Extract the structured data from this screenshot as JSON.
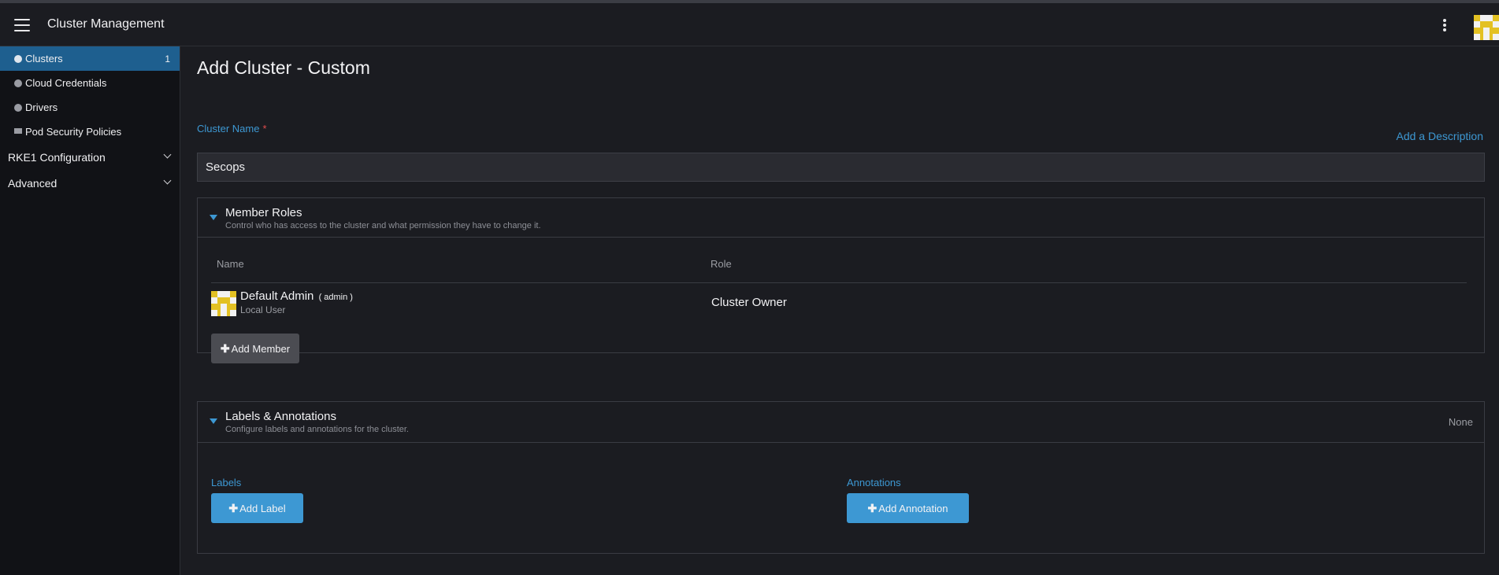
{
  "header": {
    "title": "Cluster Management",
    "menu_icon": "hamburger-icon",
    "more_icon": "kebab-icon"
  },
  "sidebar": {
    "items": [
      {
        "label": "Clusters",
        "count": "1",
        "icon": "cluster-icon",
        "active": true
      },
      {
        "label": "Cloud Credentials",
        "icon": "dot-icon"
      },
      {
        "label": "Drivers",
        "icon": "dot-icon"
      },
      {
        "label": "Pod Security Policies",
        "icon": "folder-icon"
      }
    ],
    "groups": [
      {
        "label": "RKE1 Configuration"
      },
      {
        "label": "Advanced"
      }
    ]
  },
  "main": {
    "title": "Add Cluster - Custom",
    "cluster_name_label": "Cluster Name",
    "required_mark": "*",
    "add_description_link": "Add a Description",
    "cluster_name_value": "Secops",
    "member_roles": {
      "title": "Member Roles",
      "subtitle": "Control who has access to the cluster and what permission they have to change it.",
      "columns": [
        "Name",
        "Role"
      ],
      "members": [
        {
          "name": "Default Admin",
          "username": "( admin )",
          "type": "Local User",
          "role": "Cluster Owner"
        }
      ],
      "add_member_label": "Add Member"
    },
    "labels_annotations": {
      "title": "Labels & Annotations",
      "subtitle": "Configure labels and annotations for the cluster.",
      "status": "None",
      "labels_heading": "Labels",
      "add_label_button": "Add Label",
      "annotations_heading": "Annotations",
      "add_annotation_button": "Add Annotation"
    }
  },
  "colors": {
    "accent": "#3d98d3",
    "active_sidebar": "#1e5f8f",
    "background": "#1b1c21",
    "sidebar_bg": "#111216",
    "avatar": "#e3c123"
  }
}
